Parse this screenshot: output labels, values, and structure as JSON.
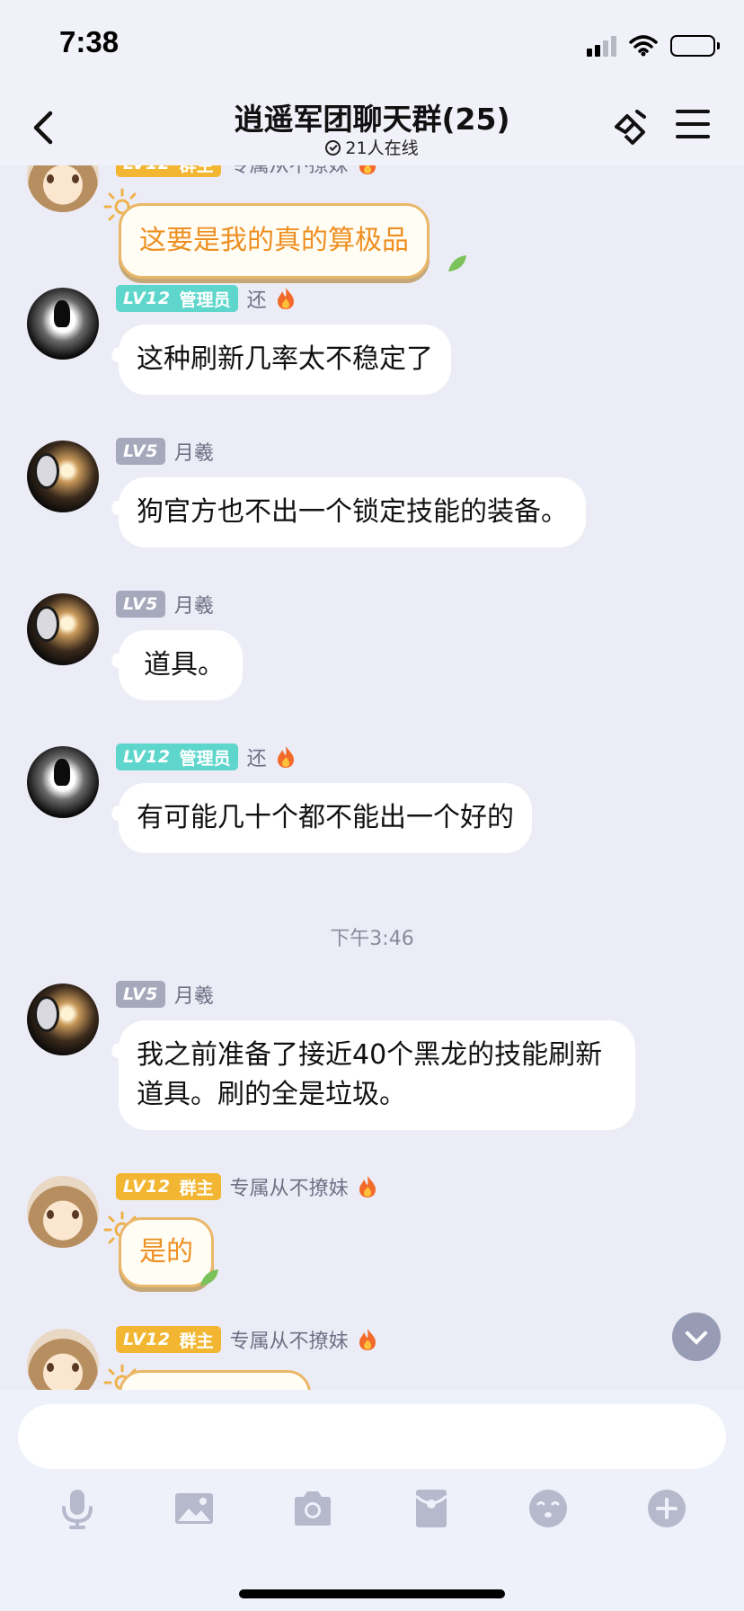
{
  "status_bar": {
    "time": "7:38"
  },
  "header": {
    "title": "逍遥军团聊天群(25)",
    "online": "21人在线"
  },
  "badge_levels": {
    "lv12": "LV12",
    "lv5": "LV5"
  },
  "messages": [
    {
      "role": "群主",
      "nick": "专属从不撩妹",
      "text": "这要是我的真的算极品"
    },
    {
      "role": "管理员",
      "nick": "还",
      "text": "这种刷新几率太不稳定了"
    },
    {
      "nick": "月羲",
      "text": "狗官方也不出一个锁定技能的装备。"
    },
    {
      "nick": "月羲",
      "text": "道具。"
    },
    {
      "role": "管理员",
      "nick": "还",
      "text": "有可能几十个都不能出一个好的"
    },
    {
      "nick": "月羲",
      "text": "我之前准备了接近40个黑龙的技能刷新道具。刷的全是垃圾。"
    },
    {
      "role": "群主",
      "nick": "专属从不撩妹",
      "text": "是的"
    },
    {
      "role": "群主",
      "nick": "专属从不撩妹"
    }
  ],
  "time_divider": "下午3:46",
  "composer": {
    "placeholder": ""
  },
  "toolbar_icons": [
    "mic-icon",
    "image-icon",
    "camera-icon",
    "red-packet-icon",
    "emoji-icon",
    "plus-icon"
  ],
  "colors": {
    "background": "#ECECF7",
    "gold_badge": "#F2B632",
    "teal_badge": "#5ED6CC",
    "gray_badge": "#A6A8BC",
    "special_bubble_text": "#EE8F21",
    "toolbar_icon": "#B6B8CC"
  }
}
